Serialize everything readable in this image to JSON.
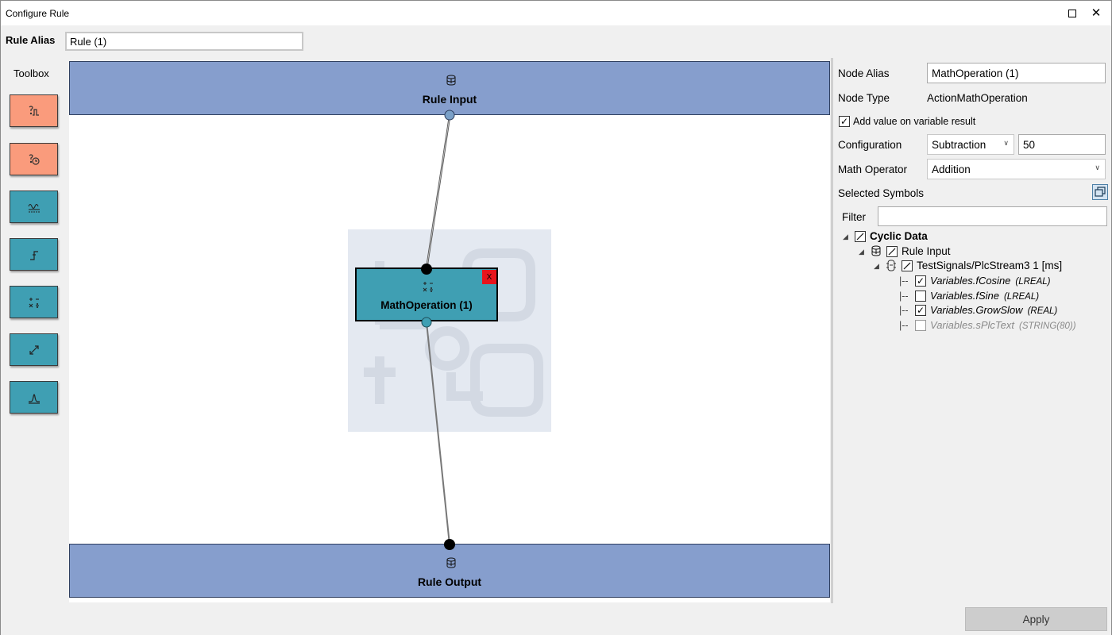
{
  "window": {
    "title": "Configure Rule",
    "maximize_icon": "maximize-icon",
    "close_icon": "close-icon",
    "close_glyph": "✕"
  },
  "rule_alias": {
    "label": "Rule Alias",
    "value": "Rule (1)"
  },
  "toolbox": {
    "label": "Toolbox",
    "items": [
      {
        "name": "condition-trigger",
        "color": "#fa9b7c",
        "icon": "signal-condition-icon"
      },
      {
        "name": "event-trigger",
        "color": "#fa9b7c",
        "icon": "signal-event-icon"
      },
      {
        "name": "data-filter",
        "color": "#3f9fb3",
        "icon": "filter-icon"
      },
      {
        "name": "step-action",
        "color": "#3f9fb3",
        "icon": "step-icon"
      },
      {
        "name": "math-operation",
        "color": "#3f9fb3",
        "icon": "math-operators-icon"
      },
      {
        "name": "scaling",
        "color": "#3f9fb3",
        "icon": "scale-arrow-icon"
      },
      {
        "name": "peak",
        "color": "#3f9fb3",
        "icon": "peak-icon"
      }
    ]
  },
  "canvas": {
    "rule_input": {
      "title": "Rule Input",
      "icon": "database-icon"
    },
    "rule_output": {
      "title": "Rule Output",
      "icon": "database-icon"
    },
    "node": {
      "title": "MathOperation (1)",
      "icon": "math-operators-icon",
      "close_label": "X"
    },
    "colors": {
      "io_block": "#869ecd",
      "action_node": "#3f9fb3",
      "trigger_node": "#fa9b7c",
      "delete": "#e8141c"
    }
  },
  "properties": {
    "node_alias": {
      "label": "Node Alias",
      "value": "MathOperation (1)"
    },
    "node_type": {
      "label": "Node Type",
      "value": "ActionMathOperation"
    },
    "add_value": {
      "label": "Add value on variable result",
      "checked": true,
      "mark": "✓"
    },
    "configuration": {
      "label": "Configuration",
      "selected": "Subtraction",
      "value": "50"
    },
    "math_operator": {
      "label": "Math Operator",
      "selected": "Addition"
    },
    "selected_symbols": {
      "label": "Selected Symbols",
      "button_icon": "window-restore-icon"
    },
    "filter": {
      "label": "Filter",
      "value": ""
    }
  },
  "tree": {
    "root": {
      "label": "Cyclic Data",
      "state": "partial"
    },
    "rule_input": {
      "label": "Rule Input",
      "state": "partial"
    },
    "stream": {
      "label": "TestSignals/PlcStream3  1 [ms]",
      "state": "partial"
    },
    "prefix": "|--",
    "variables": [
      {
        "name": "Variables.fCosine",
        "type": "(LREAL)",
        "checked": true,
        "mark": "✓",
        "enabled": true
      },
      {
        "name": "Variables.fSine",
        "type": "(LREAL)",
        "checked": false,
        "mark": "",
        "enabled": true
      },
      {
        "name": "Variables.GrowSlow",
        "type": "(REAL)",
        "checked": true,
        "mark": "✓",
        "enabled": true
      },
      {
        "name": "Variables.sPlcText",
        "type": "(STRING(80))",
        "checked": false,
        "mark": "",
        "enabled": false
      }
    ]
  },
  "footer": {
    "apply_label": "Apply"
  }
}
